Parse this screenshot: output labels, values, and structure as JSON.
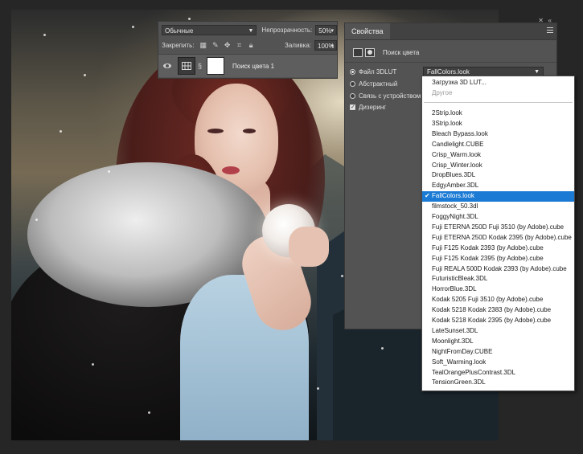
{
  "layers_panel": {
    "blend_mode": "Обычные",
    "opacity_label": "Непрозрачность:",
    "opacity_value": "50%",
    "locks_label": "Закрепить:",
    "fill_label": "Заливка:",
    "fill_value": "100%",
    "layer_name": "Поиск цвета 1",
    "icons": [
      "eye-icon",
      "adjustment-grid-icon",
      "chain-link-icon",
      "lock-transparent-pixels-icon",
      "lock-image-icon",
      "lock-position-icon",
      "lock-artboard-icon",
      "lock-all-icon"
    ]
  },
  "properties_panel": {
    "tab_label": "Свойства",
    "header_title": "Поиск цвета",
    "options": {
      "file_3dlut": "Файл 3DLUT",
      "abstract": "Абстрактный",
      "device_link": "Связь с устройством",
      "dither": "Дизеринг"
    },
    "selected_lut": "FallColors.look"
  },
  "lut_dropdown": {
    "top_items": [
      "Загрузка 3D LUT...",
      "Другое"
    ],
    "items": [
      "2Strip.look",
      "3Strip.look",
      "Bleach Bypass.look",
      "Candlelight.CUBE",
      "Crisp_Warm.look",
      "Crisp_Winter.look",
      "DropBlues.3DL",
      "EdgyAmber.3DL",
      "FallColors.look",
      "filmstock_50.3dl",
      "FoggyNight.3DL",
      "Fuji ETERNA 250D Fuji 3510 (by Adobe).cube",
      "Fuji ETERNA 250D Kodak 2395 (by Adobe).cube",
      "Fuji F125 Kodak 2393 (by Adobe).cube",
      "Fuji F125 Kodak 2395 (by Adobe).cube",
      "Fuji REALA 500D Kodak 2393 (by Adobe).cube",
      "FuturisticBleak.3DL",
      "HorrorBlue.3DL",
      "Kodak 5205 Fuji 3510 (by Adobe).cube",
      "Kodak 5218 Kodak 2383 (by Adobe).cube",
      "Kodak 5218 Kodak 2395 (by Adobe).cube",
      "LateSunset.3DL",
      "Moonlight.3DL",
      "NightFromDay.CUBE",
      "Soft_Warming.look",
      "TealOrangePlusContrast.3DL",
      "TensionGreen.3DL"
    ],
    "selected": "FallColors.look",
    "selected_color": "#1a7ad4"
  }
}
